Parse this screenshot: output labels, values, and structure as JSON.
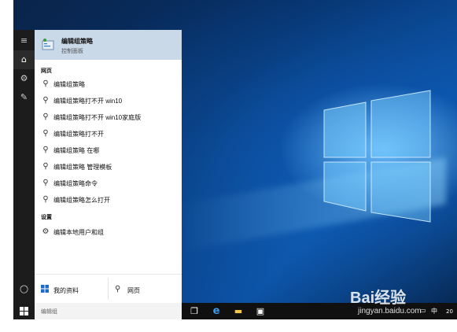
{
  "start_menu": {
    "best_match": {
      "title": "编辑组策略",
      "subtitle": "控制面板"
    },
    "web_section_label": "网页",
    "web_results": [
      "编辑组策略",
      "编辑组策略打不开 win10",
      "编辑组策略打不开 win10家庭版",
      "编辑组策略打不开",
      "编辑组策略 在哪",
      "编辑组策略 管理模板",
      "编辑组策略命令",
      "编辑组策略怎么打开"
    ],
    "settings_section_label": "设置",
    "settings_results": [
      "编辑本地用户和组"
    ],
    "bottom_left_label": "我的资料",
    "bottom_right_label": "网页"
  },
  "taskbar": {
    "search_text": "编辑组",
    "tray_ime": "中",
    "tray_clock_partial": "20"
  },
  "watermark": {
    "brand": "Bai经验",
    "url": "jingyan.baidu.com"
  },
  "colors": {
    "accent_blue": "#1f6bc4",
    "best_match_bg": "#c9d9e8",
    "rail_bg": "#1c1c1c",
    "taskbar_bg": "#101010"
  }
}
